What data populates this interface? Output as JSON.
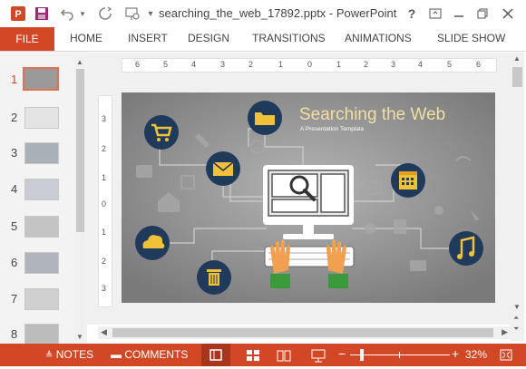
{
  "app": {
    "window_title": "searching_the_web_17892.pptx - PowerPoint"
  },
  "colors": {
    "accent": "#d24726",
    "slide_bg": "#8e8e8e",
    "circle_fill": "#1f3a5a",
    "icon_yellow": "#f2c13a",
    "hand_orange": "#f0a050",
    "sleeve_green": "#3a9a3a"
  },
  "ribbon": {
    "file": "FILE",
    "tabs": [
      "HOME",
      "INSERT",
      "DESIGN",
      "TRANSITIONS",
      "ANIMATIONS",
      "SLIDE SHOW"
    ]
  },
  "quick_access": [
    "powerpoint-icon",
    "save-icon",
    "undo-icon",
    "undo-dropdown-icon",
    "redo-icon",
    "start-from-beginning-icon",
    "customize-dropdown-icon"
  ],
  "window_buttons": {
    "help": "?",
    "ribbon_display": "ribbon-display-icon",
    "minimize": "minimize-icon",
    "restore": "restore-icon",
    "close": "close-icon"
  },
  "thumbnails": [
    {
      "number": "1",
      "active": true
    },
    {
      "number": "2",
      "active": false
    },
    {
      "number": "3",
      "active": false
    },
    {
      "number": "4",
      "active": false
    },
    {
      "number": "5",
      "active": false
    },
    {
      "number": "6",
      "active": false
    },
    {
      "number": "7",
      "active": false
    },
    {
      "number": "8",
      "active": false
    }
  ],
  "ruler": {
    "horizontal": [
      "6",
      "5",
      "4",
      "3",
      "2",
      "1",
      "0",
      "1",
      "2",
      "3",
      "4",
      "5",
      "6"
    ],
    "vertical": [
      "3",
      "2",
      "1",
      "0",
      "1",
      "2",
      "3"
    ]
  },
  "slide": {
    "title": "Searching the Web",
    "subtitle": "A Presentation Template"
  },
  "status": {
    "notes": "NOTES",
    "comments": "COMMENTS",
    "zoom": "32%"
  }
}
